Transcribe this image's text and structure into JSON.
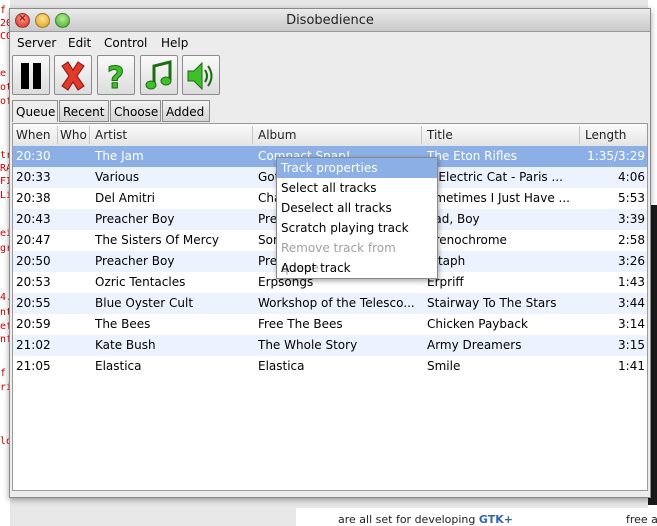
{
  "window": {
    "title": "Disobedience"
  },
  "menubar": [
    "Server",
    "Edit",
    "Control",
    "Help"
  ],
  "toolbar": [
    "pause-icon",
    "remove-icon",
    "help-icon",
    "music-icon",
    "volume-icon"
  ],
  "tabs": [
    "Queue",
    "Recent",
    "Choose",
    "Added"
  ],
  "table": {
    "columns": [
      "When",
      "Who",
      "Artist",
      "Album",
      "Title",
      "Length"
    ],
    "rows": [
      {
        "when": "20:30",
        "who": "",
        "artist": "The Jam",
        "album": "Compact Snap!",
        "title": "The Eton Rifles",
        "length": "1:35/3:29"
      },
      {
        "when": "20:33",
        "who": "",
        "artist": "Various",
        "album": "Got",
        "title": "g Electric Cat - Paris ...",
        "length": "4:06"
      },
      {
        "when": "20:38",
        "who": "",
        "artist": "Del Amitri",
        "album": "Cha",
        "title": "ometimes I Just Have ...",
        "length": "5:53"
      },
      {
        "when": "20:43",
        "who": "",
        "artist": "Preacher Boy",
        "album": "Prea",
        "title": "ead, Boy",
        "length": "3:39"
      },
      {
        "when": "20:47",
        "who": "",
        "artist": "The Sisters Of Mercy",
        "album": "Son",
        "title": "drenochrome",
        "length": "2:58"
      },
      {
        "when": "20:50",
        "who": "",
        "artist": "Preacher Boy",
        "album": "Prea",
        "title": "pitaph",
        "length": "3:26"
      },
      {
        "when": "20:53",
        "who": "",
        "artist": "Ozric Tentacles",
        "album": "Erpsongs",
        "title": "Erpriff",
        "length": "1:43"
      },
      {
        "when": "20:55",
        "who": "",
        "artist": "Blue Oyster Cult",
        "album": "Workshop of the Telesco...",
        "title": "Stairway To The Stars",
        "length": "3:44"
      },
      {
        "when": "20:59",
        "who": "",
        "artist": "The Bees",
        "album": "Free The Bees",
        "title": "Chicken Payback",
        "length": "3:14"
      },
      {
        "when": "21:02",
        "who": "",
        "artist": "Kate Bush",
        "album": "The Whole Story",
        "title": "Army Dreamers",
        "length": "3:15"
      },
      {
        "when": "21:05",
        "who": "",
        "artist": "Elastica",
        "album": "Elastica",
        "title": "Smile",
        "length": "1:41"
      }
    ]
  },
  "context_menu": [
    {
      "label": "Track properties",
      "state": "highlighted"
    },
    {
      "label": "Select all tracks",
      "state": "normal"
    },
    {
      "label": "Deselect all tracks",
      "state": "normal"
    },
    {
      "label": "Scratch playing track",
      "state": "normal"
    },
    {
      "label": "Remove track from queue",
      "state": "disabled"
    },
    {
      "label": "Adopt track",
      "state": "normal"
    }
  ],
  "background": {
    "left_fragments": [
      "f DisOrder",
      "20",
      "CO",
      "e",
      "ot",
      "of",
      "tr",
      "RA",
      "FI",
      "Li",
      "ei",
      "gr",
      "4.",
      "nt",
      "ef",
      "nf",
      "f",
      "ri",
      "ld"
    ],
    "bottom_text_prefix": "are all set for developing ",
    "bottom_text_link": "GTK+",
    "bottom_text_right": "free a"
  },
  "colors": {
    "selection": "#8cb0e6",
    "stripe": "#edf3fe",
    "disabled": "#a0a0a0"
  }
}
